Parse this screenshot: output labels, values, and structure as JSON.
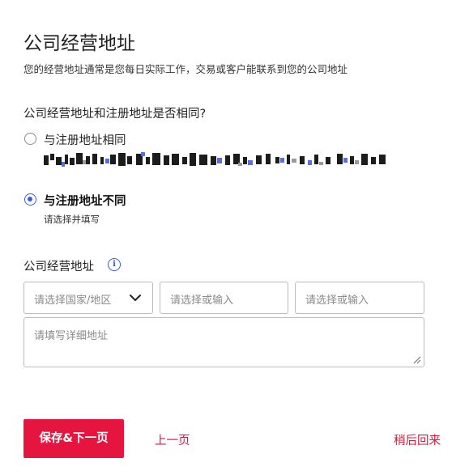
{
  "page": {
    "title": "公司经营地址",
    "subtitle": "您的经营地址通常是您每日实际工作，交易或客户能联系到您的公司地址"
  },
  "same_address": {
    "question": "公司经营地址和注册地址是否相同?",
    "options": [
      {
        "label": "与注册地址相同",
        "checked": false
      },
      {
        "label": "与注册地址不同",
        "checked": true
      }
    ],
    "different_hint": "请选择并填写"
  },
  "business_address": {
    "label": "公司经营地址",
    "info_icon": "info-icon",
    "country_placeholder": "请选择国家/地区",
    "province_placeholder": "请选择或输入",
    "city_placeholder": "请选择或输入",
    "detail_placeholder": "请填写详细地址"
  },
  "actions": {
    "save_next": "保存&下一页",
    "prev": "上一页",
    "later": "稍后回来"
  },
  "colors": {
    "accent": "#e6153f",
    "radio_selected": "#3a5ae8",
    "link": "#d8173c"
  }
}
